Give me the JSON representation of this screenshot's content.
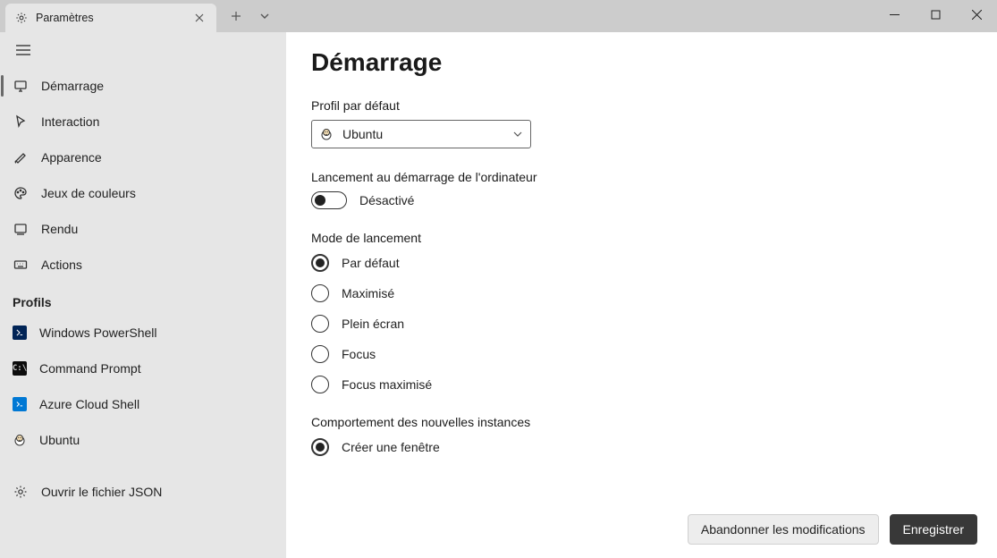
{
  "titlebar": {
    "tab_label": "Paramètres"
  },
  "sidebar": {
    "items": [
      {
        "label": "Démarrage",
        "selected": true
      },
      {
        "label": "Interaction"
      },
      {
        "label": "Apparence"
      },
      {
        "label": "Jeux de couleurs"
      },
      {
        "label": "Rendu"
      },
      {
        "label": "Actions"
      }
    ],
    "section_label": "Profils",
    "profiles": [
      {
        "label": "Windows PowerShell"
      },
      {
        "label": "Command Prompt"
      },
      {
        "label": "Azure Cloud Shell"
      },
      {
        "label": "Ubuntu"
      }
    ],
    "json_label": "Ouvrir le fichier JSON"
  },
  "content": {
    "title": "Démarrage",
    "default_profile": {
      "label": "Profil par défaut",
      "value": "Ubuntu"
    },
    "launch_on_startup": {
      "label": "Lancement au démarrage de l'ordinateur",
      "status": "Désactivé"
    },
    "launch_mode": {
      "label": "Mode de lancement",
      "options": [
        {
          "label": "Par défaut",
          "selected": true
        },
        {
          "label": "Maximisé"
        },
        {
          "label": "Plein écran"
        },
        {
          "label": "Focus"
        },
        {
          "label": "Focus maximisé"
        }
      ]
    },
    "new_instance": {
      "label": "Comportement des nouvelles instances",
      "options": [
        {
          "label": "Créer une fenêtre",
          "selected": true
        }
      ]
    }
  },
  "footer": {
    "discard": "Abandonner les modifications",
    "save": "Enregistrer"
  }
}
